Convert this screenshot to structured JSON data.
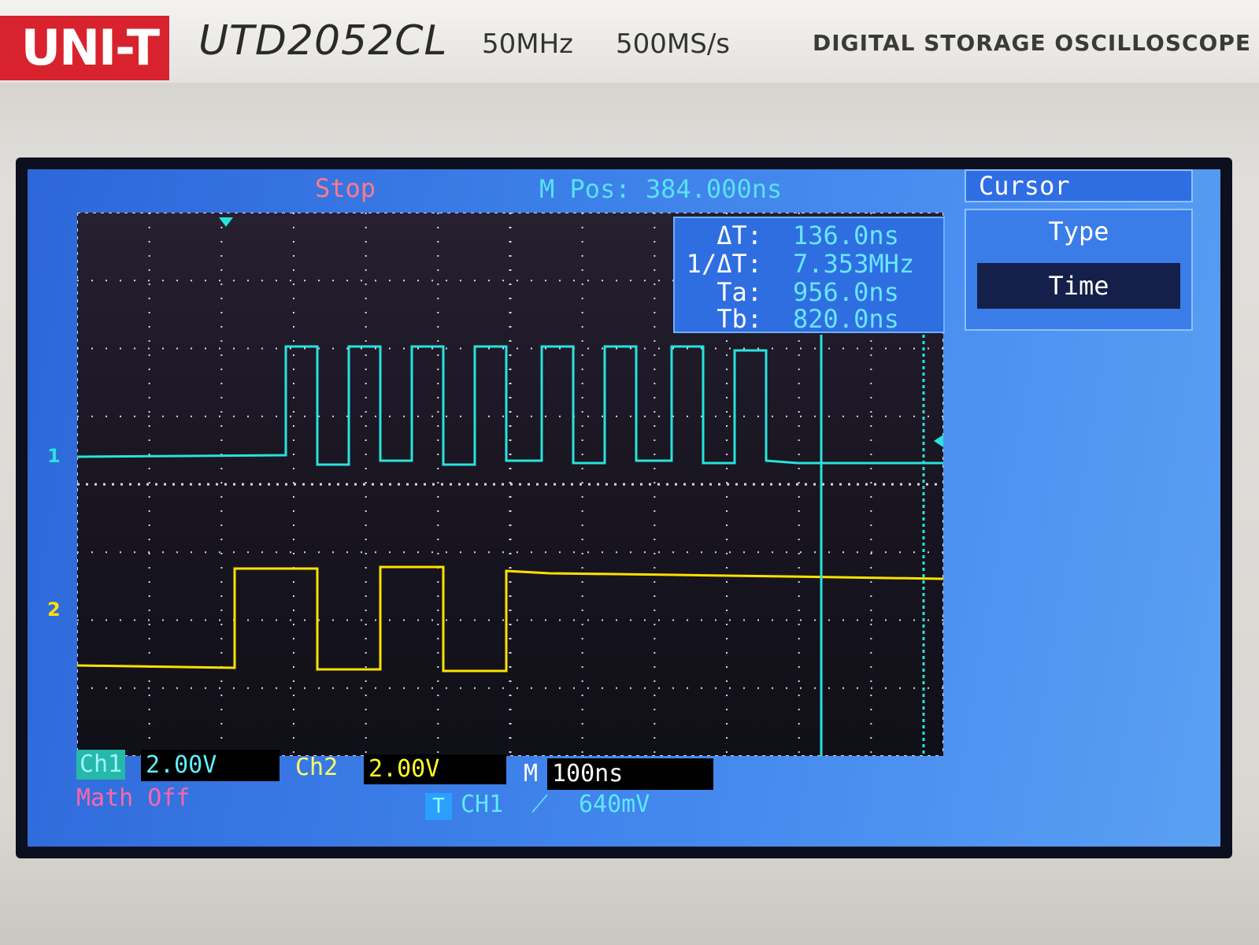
{
  "device": {
    "brand": "UNI-T",
    "model": "UTD2052CL",
    "bandwidth": "50MHz",
    "sample_rate": "500MS/s",
    "description": "DIGITAL STORAGE OSCILLOSCOPE"
  },
  "screen": {
    "status": "Stop",
    "m_pos": "M Pos: 384.000ns"
  },
  "cursor_panel": {
    "rows": [
      {
        "label": "ΔT:",
        "value": "136.0ns"
      },
      {
        "label": "1/ΔT:",
        "value": "7.353MHz"
      },
      {
        "label": "Ta:",
        "value": "956.0ns"
      },
      {
        "label": "Tb:",
        "value": "820.0ns"
      }
    ]
  },
  "menu": {
    "title": "Cursor",
    "type_label": "Type",
    "type_value": "Time"
  },
  "channels": {
    "ch1": {
      "label": "Ch1",
      "scale": "2.00V",
      "marker": "1",
      "color": "#27e3dc"
    },
    "ch2": {
      "label": "Ch2",
      "scale": "2.00V",
      "marker": "2",
      "color": "#ffe100"
    }
  },
  "timebase": {
    "label": "M",
    "scale": "100ns"
  },
  "math": "Math Off",
  "trigger": {
    "badge": "T",
    "source": "CH1",
    "edge": "⟋",
    "level": "640mV"
  }
}
